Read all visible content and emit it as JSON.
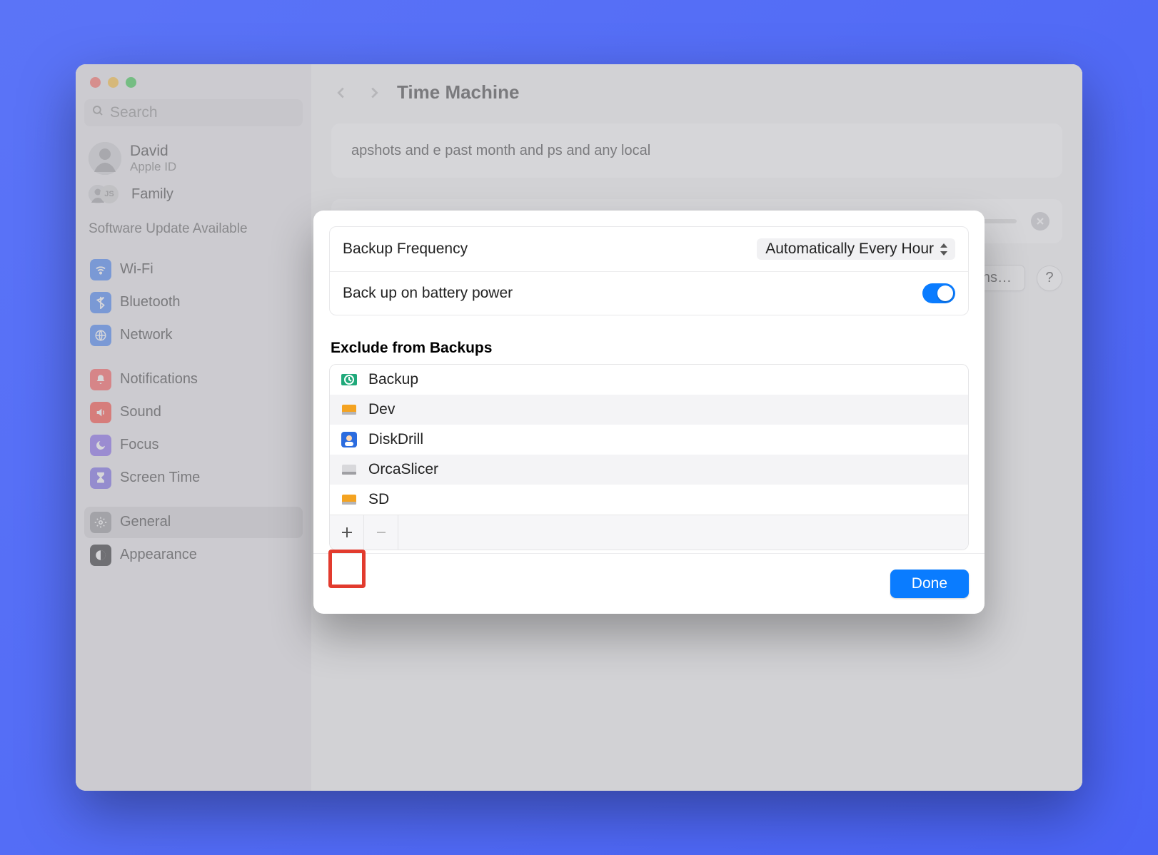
{
  "window": {
    "title": "Time Machine"
  },
  "search": {
    "placeholder": "Search"
  },
  "user": {
    "name": "David",
    "subtitle": "Apple ID"
  },
  "family": {
    "label": "Family",
    "badge": "JS"
  },
  "update_note": "Software Update Available",
  "sidebar": {
    "group1": [
      {
        "label": "Wi-Fi"
      },
      {
        "label": "Bluetooth"
      },
      {
        "label": "Network"
      }
    ],
    "group2": [
      {
        "label": "Notifications"
      },
      {
        "label": "Sound"
      },
      {
        "label": "Focus"
      },
      {
        "label": "Screen Time"
      }
    ],
    "group3": [
      {
        "label": "General"
      },
      {
        "label": "Appearance"
      }
    ]
  },
  "main": {
    "info_text": "apshots and e past month and ps and any local",
    "options_button": "Options…",
    "help_button": "?"
  },
  "sheet": {
    "backup_frequency_label": "Backup Frequency",
    "backup_frequency_value": "Automatically Every Hour",
    "battery_label": "Back up on battery power",
    "battery_on": true,
    "exclude_title": "Exclude from Backups",
    "exclude_items": [
      {
        "name": "Backup",
        "icon": "timemachine-drive"
      },
      {
        "name": "Dev",
        "icon": "external-drive-yellow"
      },
      {
        "name": "DiskDrill",
        "icon": "app-diskdrill"
      },
      {
        "name": "OrcaSlicer",
        "icon": "external-drive-gray"
      },
      {
        "name": "SD",
        "icon": "external-drive-yellow"
      }
    ],
    "done_label": "Done"
  }
}
